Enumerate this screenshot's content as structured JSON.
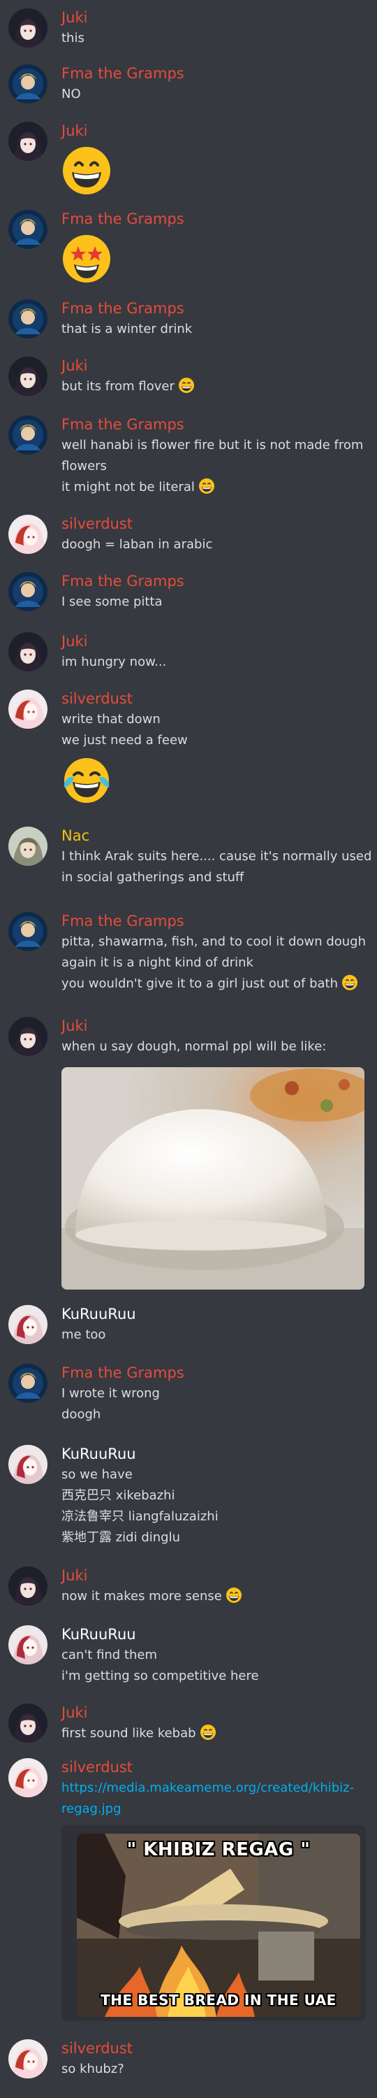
{
  "colors": {
    "background": "#36393f",
    "text": "#dcddde",
    "juki": "#e74c3c",
    "fma": "#e74c3c",
    "silverdust": "#e74c3c",
    "nac": "#f1c40f",
    "kuruuruu": "#ffffff",
    "link": "#00aff4"
  },
  "messages": [
    {
      "author": "Juki",
      "lines": [
        "this"
      ]
    },
    {
      "author": "Fma the Gramps",
      "lines": [
        "NO"
      ]
    },
    {
      "author": "Juki",
      "emoji": "grinning-face-emoji"
    },
    {
      "author": "Fma the Gramps",
      "emoji": "star-struck-face-emoji"
    },
    {
      "author": "Fma the Gramps",
      "lines": [
        "that is a winter drink"
      ]
    },
    {
      "author": "Juki",
      "lines": [
        "but its from flover"
      ],
      "inline_emoji": "grin-emoji"
    },
    {
      "author": "Fma the Gramps",
      "lines": [
        "well hanabi is flower fire but it is not made from",
        "flowers",
        "it might not be literal"
      ],
      "inline_emoji": "grin-emoji"
    },
    {
      "author": "silverdust",
      "lines": [
        "doogh = laban in arabic"
      ]
    },
    {
      "author": "Fma the Gramps",
      "lines": [
        "I see some pitta"
      ]
    },
    {
      "author": "Juki",
      "lines": [
        "im hungry now..."
      ]
    },
    {
      "author": "silverdust",
      "lines": [
        "write that down",
        "we just need a feew"
      ],
      "emoji": "tears-of-joy-emoji"
    },
    {
      "author": "Nac",
      "lines": [
        "I think Arak suits here.... cause it's normally used",
        "in social gatherings and stuff"
      ]
    },
    {
      "author": "Fma the Gramps",
      "lines": [
        "pitta, shawarma, fish, and to cool it down dough",
        "again it is a night kind of drink",
        "you wouldn't give it to a girl just out of bath"
      ],
      "inline_emoji": "grin-emoji"
    },
    {
      "author": "Juki",
      "lines": [
        "when u say dough, normal ppl will be like:"
      ],
      "attachment": "dough-photo"
    },
    {
      "author": "KuRuuRuu",
      "lines": [
        "me too"
      ]
    },
    {
      "author": "Fma the Gramps",
      "lines": [
        "I wrote it wrong",
        "doogh"
      ]
    },
    {
      "author": "KuRuuRuu",
      "lines": [
        "so we have",
        "西克巴只  xikebazhi",
        "凉法鲁宰只 liangfaluzaizhi",
        "紫地丁露 zidi dinglu"
      ]
    },
    {
      "author": "Juki",
      "lines": [
        "now it makes more sense"
      ],
      "inline_emoji": "grin-emoji"
    },
    {
      "author": "KuRuuRuu",
      "lines": [
        "can't find them",
        "i'm getting so competitive here"
      ]
    },
    {
      "author": "Juki",
      "lines": [
        "first sound like kebab"
      ],
      "inline_emoji": "grin-emoji"
    },
    {
      "author": "silverdust",
      "link_lines": [
        "https://media.makeameme.org/created/khibiz-",
        "regag.jpg"
      ],
      "embed": {
        "top_text": "\" KHIBIZ REGAG \"",
        "bottom_text": "THE BEST BREAD IN THE UAE"
      }
    },
    {
      "author": "silverdust",
      "lines": [
        "so khubz?"
      ]
    }
  ]
}
